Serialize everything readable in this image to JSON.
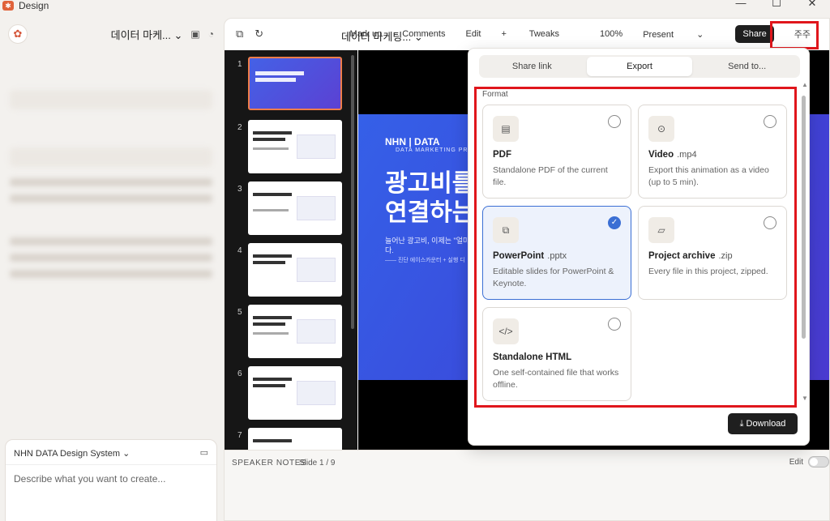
{
  "window": {
    "title": "Design",
    "controls": [
      "—",
      "☐",
      "✕"
    ]
  },
  "left_pane": {
    "project_title": "데이터 마케...",
    "design_system": "NHN DATA Design System",
    "composer_placeholder": "Describe what you want to create..."
  },
  "toolbar": {
    "deck_title": "데이터 마케팅...",
    "markup": "Mark up",
    "comments": "Comments",
    "edit": "Edit",
    "tweaks": "Tweaks",
    "zoom": "100%",
    "present": "Present",
    "share": "Share",
    "user_cut": "주주"
  },
  "thumbnails": {
    "numbers": [
      "1",
      "2",
      "3",
      "4",
      "5",
      "6",
      "7"
    ]
  },
  "slide": {
    "brand": "NHN | DATA",
    "brand_sub": "DATA MARKETING PROPOS",
    "headline_1": "광고비를",
    "headline_2": "연결하는",
    "sub_1": "늘어난 광고비, 이제는 \"얼마",
    "sub_2": "다.",
    "sub_3": "—— 진단 에이스카운터 + 실행 디"
  },
  "notes": {
    "label": "SPEAKER NOTES",
    "slide_num": "Slide 1 / 9",
    "edit": "Edit"
  },
  "share_popover": {
    "tabs": [
      "Share link",
      "Export",
      "Send to..."
    ],
    "active_tab": "Export",
    "format_label": "Format",
    "formats": [
      {
        "name": "PDF",
        "ext": "",
        "desc": "Standalone PDF of the current file.",
        "icon": "document-icon",
        "selected": false
      },
      {
        "name": "Video",
        "ext": ".mp4",
        "desc": "Export this animation as a video (up to 5 min).",
        "icon": "play-icon",
        "selected": false
      },
      {
        "name": "PowerPoint",
        "ext": ".pptx",
        "desc": "Editable slides for PowerPoint & Keynote.",
        "icon": "slides-icon",
        "selected": true
      },
      {
        "name": "Project archive",
        "ext": ".zip",
        "desc": "Every file in this project, zipped.",
        "icon": "folder-icon",
        "selected": false
      },
      {
        "name": "Standalone HTML",
        "ext": "",
        "desc": "One self-contained file that works offline.",
        "icon": "code-icon",
        "selected": false
      }
    ],
    "download": "Download"
  },
  "colors": {
    "accent": "#3b6fd4",
    "highlight": "#e0161c",
    "slide_blue": "#3560e8"
  }
}
